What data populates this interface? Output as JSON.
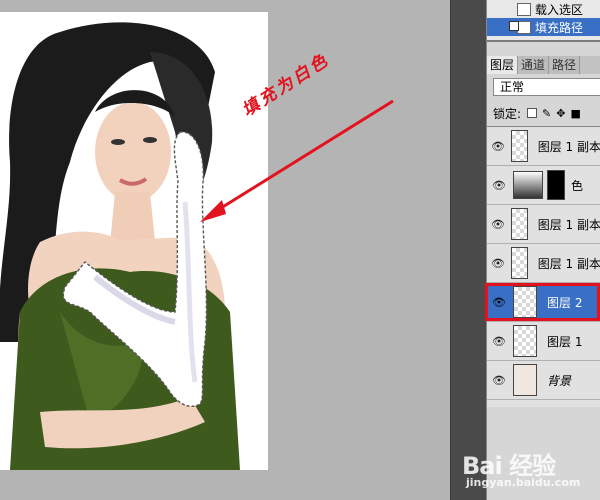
{
  "paths_panel": {
    "items": [
      {
        "label": "载入选区",
        "selected": false
      },
      {
        "label": "填充路径",
        "selected": true
      }
    ]
  },
  "layers_panel": {
    "tabs": [
      "图层",
      "通道",
      "路径"
    ],
    "active_tab": 0,
    "blend_mode": "正常",
    "lock_label": "锁定:",
    "layers": [
      {
        "name": "图层 1 副本",
        "selected": false,
        "italic": false
      },
      {
        "name": "色",
        "selected": false,
        "italic": false,
        "type": "adjustment"
      },
      {
        "name": "图层 1 副本",
        "selected": false,
        "italic": false
      },
      {
        "name": "图层 1 副本",
        "selected": false,
        "italic": false
      },
      {
        "name": "图层 2",
        "selected": true,
        "italic": false
      },
      {
        "name": "图层 1",
        "selected": false,
        "italic": false
      },
      {
        "name": "背景",
        "selected": false,
        "italic": true
      }
    ]
  },
  "canvas": {
    "annotation": "填充为白色",
    "annotation_color": "#e3121f"
  },
  "watermark": {
    "brand": "Bai 经验",
    "url": "jingyan.baidu.com"
  },
  "colors": {
    "selection": "#3a6fc6",
    "highlight_box": "#e3121f",
    "canvas_bg": "#b4b4b4"
  }
}
